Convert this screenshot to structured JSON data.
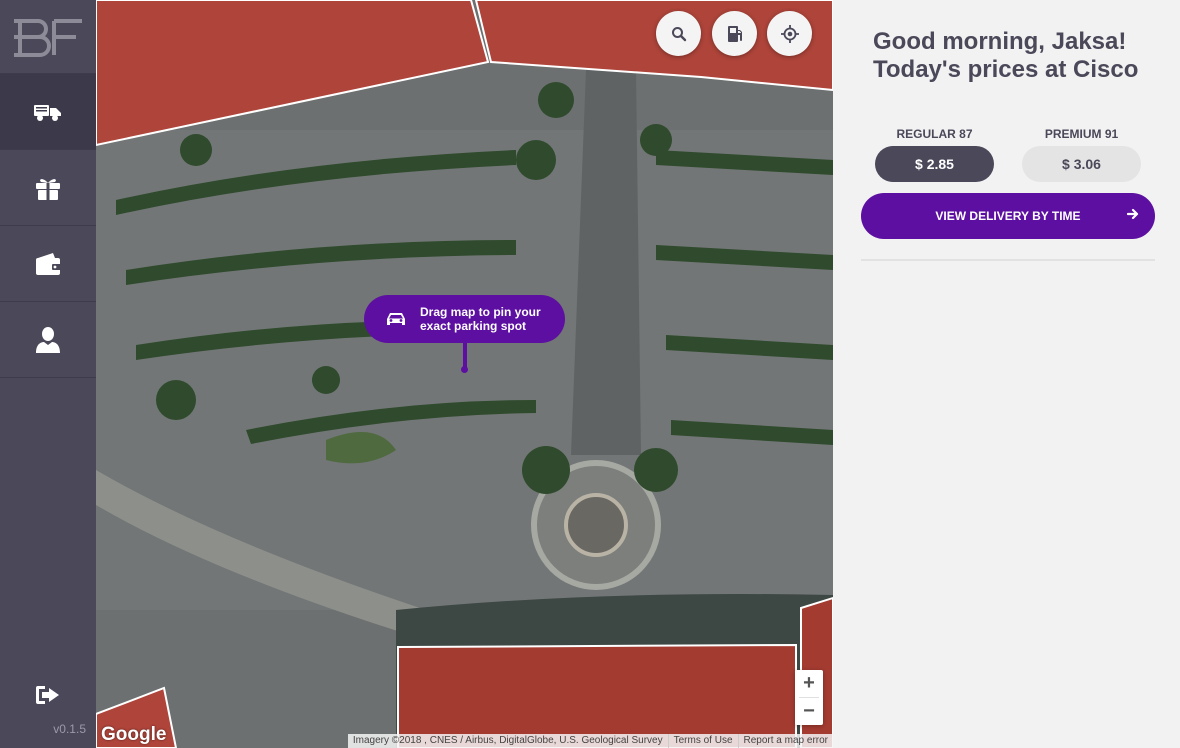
{
  "sidebar": {
    "logo_text": "BF",
    "items": [
      {
        "icon": "truck-icon",
        "active": true
      },
      {
        "icon": "gift-icon",
        "active": false
      },
      {
        "icon": "wallet-icon",
        "active": false
      },
      {
        "icon": "user-icon",
        "active": false
      }
    ],
    "logout_icon": "logout-icon",
    "version": "v0.1.5"
  },
  "map": {
    "buttons": [
      {
        "icon": "search-icon"
      },
      {
        "icon": "fuel-pump-icon"
      },
      {
        "icon": "locate-icon"
      }
    ],
    "tooltip": "Drag map to pin your exact parking spot",
    "tooltip_icon": "car-icon",
    "zoom_in": "+",
    "zoom_out": "−",
    "google_logo": "Google",
    "attribution": {
      "imagery": "Imagery ©2018 , CNES / Airbus, DigitalGlobe, U.S. Geological Survey",
      "terms": "Terms of Use",
      "report": "Report a map error"
    }
  },
  "panel": {
    "greeting_line1": "Good morning, Jaksa!",
    "greeting_line2": "Today's prices at Cisco",
    "fuels": [
      {
        "label": "REGULAR 87",
        "price": "$ 2.85",
        "selected": true
      },
      {
        "label": "PREMIUM 91",
        "price": "$ 3.06",
        "selected": false
      }
    ],
    "cta_label": "VIEW DELIVERY BY TIME",
    "cta_icon": "arrow-right-icon"
  },
  "colors": {
    "sidebar_bg": "#4a4859",
    "accent_purple": "#5c0fa0",
    "panel_bg": "#f2f2f2",
    "zone_red": "#c0392b"
  }
}
